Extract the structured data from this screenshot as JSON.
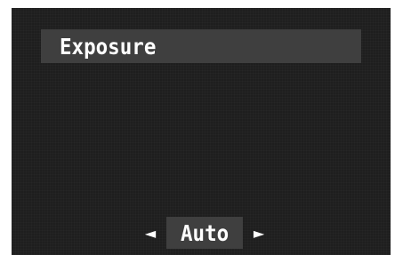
{
  "menu": {
    "title": "Exposure"
  },
  "selector": {
    "left_arrow": "◄",
    "value": "Auto",
    "right_arrow": "►"
  }
}
